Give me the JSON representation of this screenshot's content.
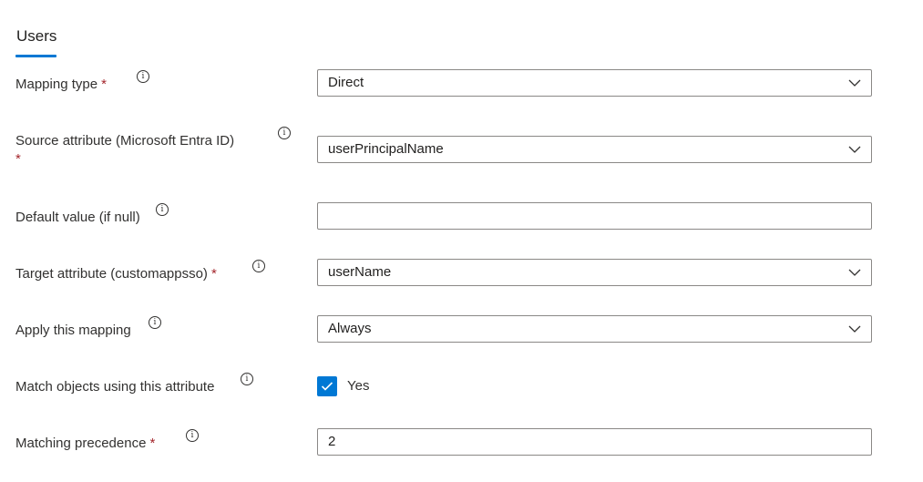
{
  "tab": {
    "label": "Users"
  },
  "colors": {
    "accent": "#0078d4",
    "required": "#a4262c",
    "border": "#8a8886"
  },
  "rows": {
    "mapping_type": {
      "label": "Mapping type",
      "required": "*",
      "value": "Direct",
      "icon": "info-icon"
    },
    "source_attribute": {
      "label": "Source attribute (Microsoft Entra ID)",
      "required": "*",
      "value": "userPrincipalName",
      "icon": "info-icon"
    },
    "default_value": {
      "label": "Default value (if null)",
      "value": "",
      "icon": "info-icon"
    },
    "target_attribute": {
      "label": "Target attribute (customappsso)",
      "required": "*",
      "value": "userName",
      "icon": "info-icon"
    },
    "apply_mapping": {
      "label": "Apply this mapping",
      "value": "Always",
      "icon": "info-icon"
    },
    "match_objects": {
      "label": "Match objects using this attribute",
      "checked": true,
      "checkbox_label": "Yes",
      "icon": "info-icon"
    },
    "matching_precedence": {
      "label": "Matching precedence",
      "required": "*",
      "value": "2",
      "icon": "info-icon"
    }
  }
}
